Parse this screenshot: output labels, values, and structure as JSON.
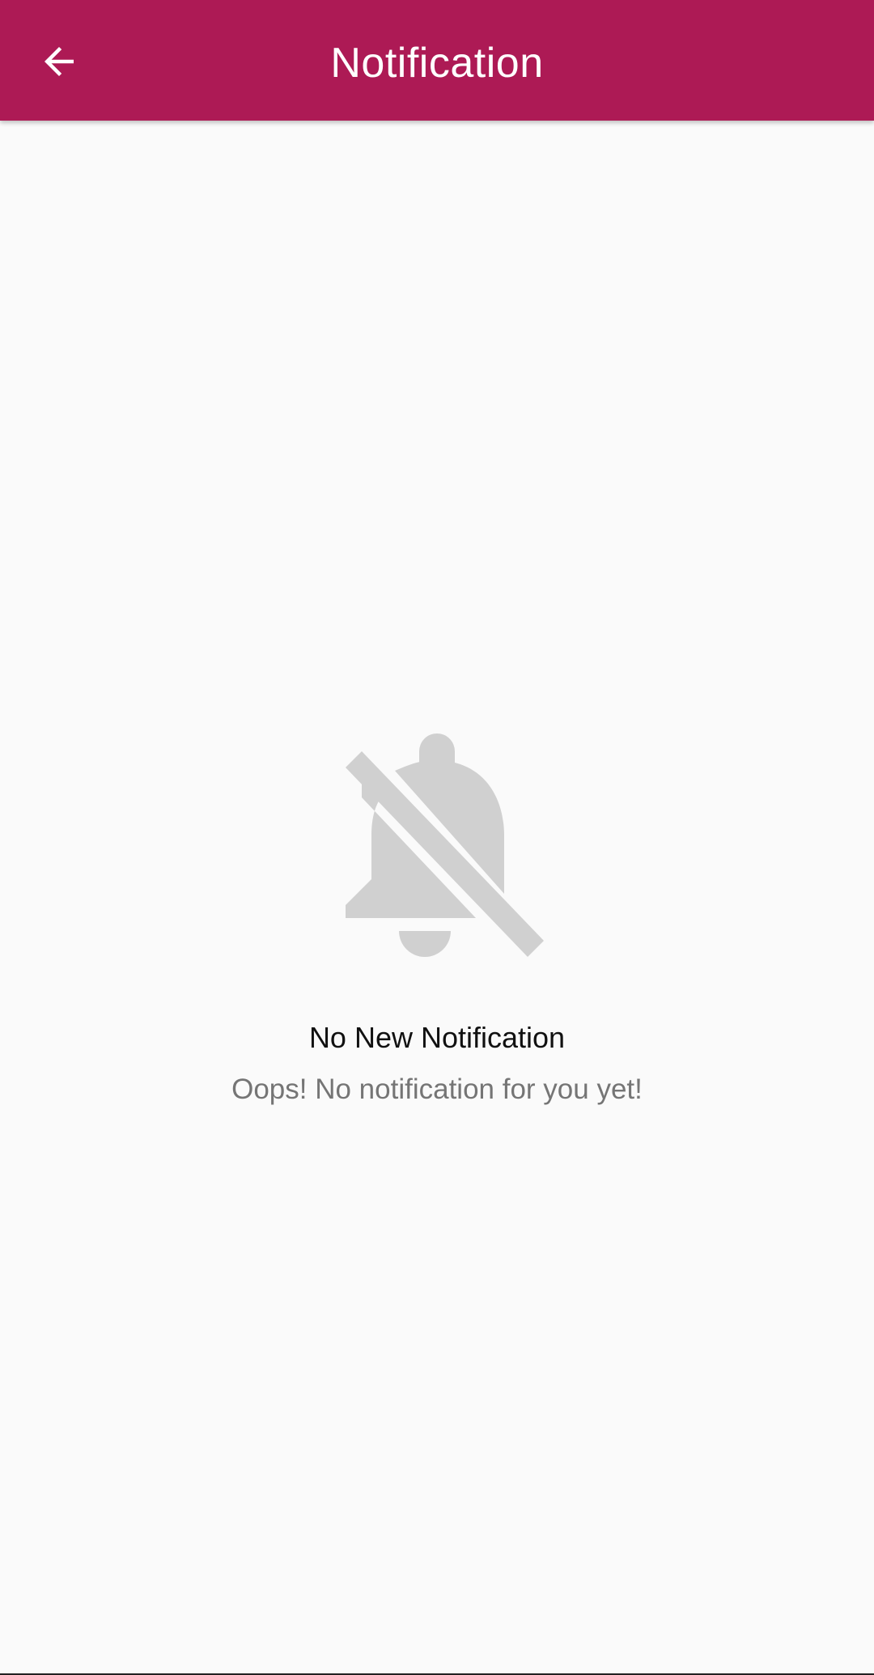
{
  "app_bar": {
    "title": "Notification",
    "background_color": "#ad1a55",
    "back_icon": "arrow-back-icon"
  },
  "empty_state": {
    "icon": "notifications-off-icon",
    "icon_color": "#d0d0d0",
    "title": "No New Notification",
    "subtitle": "Oops! No notification for you yet!"
  }
}
